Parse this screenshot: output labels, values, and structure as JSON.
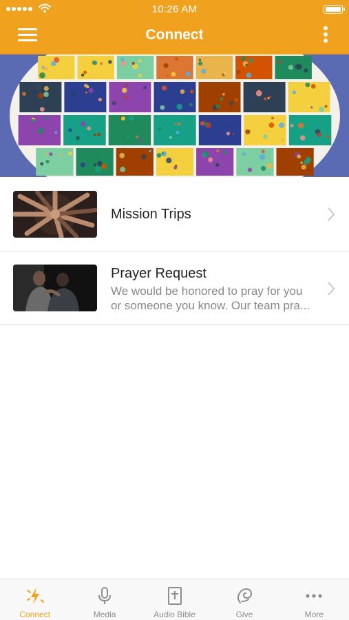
{
  "status_bar": {
    "time": "10:26 AM"
  },
  "nav": {
    "title": "Connect"
  },
  "list": [
    {
      "title": "Mission Trips",
      "description_lines": []
    },
    {
      "title": "Prayer Request",
      "description_lines": [
        "We would be honored to pray for you",
        "or someone you know. Our team pra..."
      ]
    }
  ],
  "tabs": [
    {
      "label": "Connect",
      "icon": "lightning-icon",
      "active": true
    },
    {
      "label": "Media",
      "icon": "microphone-icon",
      "active": false
    },
    {
      "label": "Audio Bible",
      "icon": "bible-icon",
      "active": false
    },
    {
      "label": "Give",
      "icon": "give-icon",
      "active": false
    },
    {
      "label": "More",
      "icon": "ellipsis-icon",
      "active": false
    }
  ],
  "colors": {
    "accent": "#f0a21e",
    "inactive": "#8e8e8e",
    "banner_background": "#4d5fa8"
  }
}
